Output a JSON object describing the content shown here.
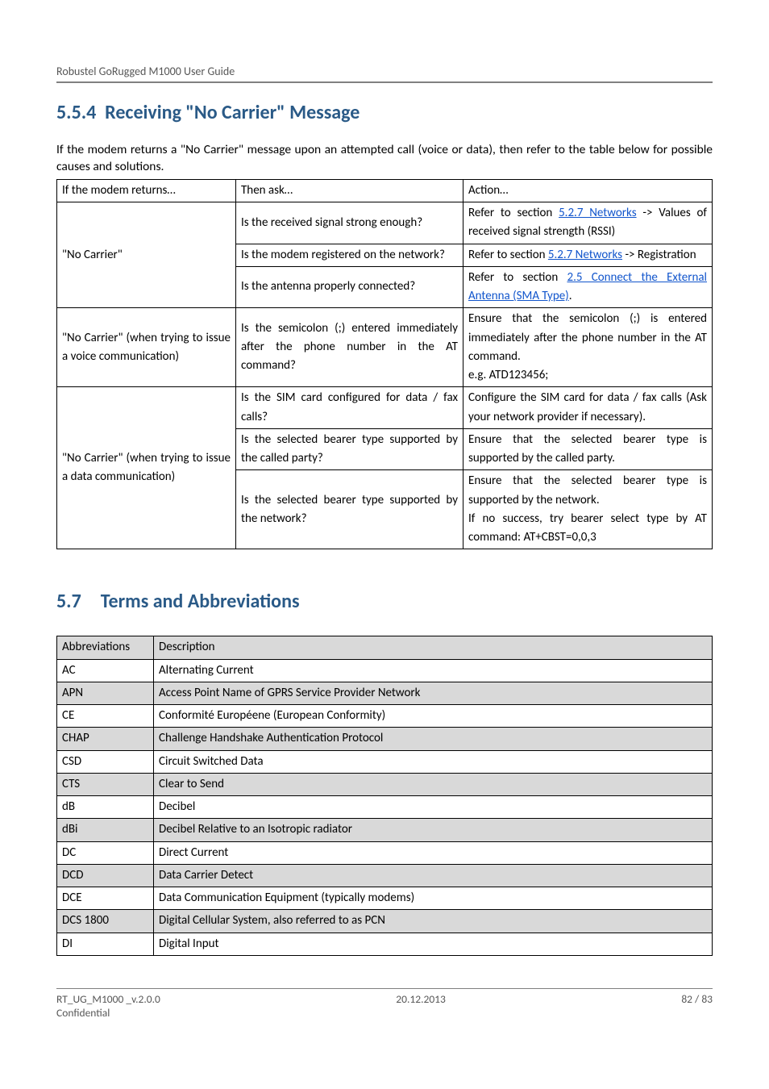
{
  "header": {
    "left": "Robustel GoRugged M1000 User Guide"
  },
  "section1": {
    "num": "5.5.4",
    "title": "Receiving \"No Carrier\" Message",
    "intro": "If the modem returns a \"No Carrier\" message upon an attempted call (voice or data), then refer to the table below for possible causes and solutions."
  },
  "table1": {
    "headers": {
      "c1": "If the modem returns…",
      "c2": "Then ask…",
      "c3": "Action…"
    },
    "rows": [
      {
        "c1": "\"No Carrier\"",
        "qas": [
          {
            "q": "Is the received signal strong enough?",
            "a_pre": "Refer to section ",
            "a_link": "5.2.7 Networks",
            "a_post": " -> Values of received signal strength (RSSI)"
          },
          {
            "q": "Is the modem registered on the network?",
            "a_pre": "Refer to section ",
            "a_link": "5.2.7 Networks",
            "a_post": " -> Registration"
          },
          {
            "q": "Is the antenna properly connected?",
            "a_pre": "Refer to section ",
            "a_link": "2.5 Connect the External Antenna (SMA Type)",
            "a_post": "."
          }
        ]
      },
      {
        "c1": "\"No Carrier\" (when trying to issue a voice communication)",
        "qas": [
          {
            "q": "Is the semicolon (;) entered immediately after the phone number in the AT command?",
            "a": "Ensure that the semicolon (;) is entered immediately after the phone number in the AT command.\ne.g. ATD123456;"
          }
        ]
      },
      {
        "c1": "\"No Carrier\" (when trying to issue a data communication)",
        "qas": [
          {
            "q": "Is the SIM card configured for data / fax calls?",
            "a": "Configure the SIM card for data / fax calls (Ask your network provider if necessary)."
          },
          {
            "q": "Is the selected bearer type supported by the called party?",
            "a": "Ensure that the selected bearer type is supported by the called party."
          },
          {
            "q": "Is the selected bearer type supported by the network?",
            "a": "Ensure that the selected bearer type is supported by the network.\nIf no success, try bearer select type by AT command: AT+CBST=0,0,3"
          }
        ]
      }
    ]
  },
  "section2": {
    "num": "5.7",
    "title": "Terms and Abbreviations"
  },
  "table2": {
    "headers": {
      "c1": "Abbreviations",
      "c2": "Description"
    },
    "rows": [
      {
        "abbr": "AC",
        "desc": "Alternating Current"
      },
      {
        "abbr": "APN",
        "desc": "Access Point Name of GPRS Service Provider Network",
        "shaded": true
      },
      {
        "abbr": "CE",
        "desc": "Conformité Européene (European Conformity)"
      },
      {
        "abbr": "CHAP",
        "desc": "Challenge Handshake Authentication Protocol",
        "shaded": true
      },
      {
        "abbr": "CSD",
        "desc": "Circuit Switched Data"
      },
      {
        "abbr": "CTS",
        "desc": "Clear to Send",
        "shaded": true
      },
      {
        "abbr": "dB",
        "desc": "Decibel"
      },
      {
        "abbr": "dBi",
        "desc": "Decibel Relative to an Isotropic radiator",
        "shaded": true
      },
      {
        "abbr": "DC",
        "desc": "Direct Current"
      },
      {
        "abbr": "DCD",
        "desc": "Data Carrier Detect",
        "shaded": true
      },
      {
        "abbr": "DCE",
        "desc": "Data Communication Equipment (typically modems)"
      },
      {
        "abbr": "DCS 1800",
        "desc": "Digital Cellular System, also referred to as PCN",
        "shaded": true
      },
      {
        "abbr": "DI",
        "desc": "Digital Input"
      }
    ]
  },
  "footer": {
    "left1": "RT_UG_M1000 _v.2.0.0",
    "left2": "Confidential",
    "center": "20.12.2013",
    "right": "82 / 83"
  }
}
